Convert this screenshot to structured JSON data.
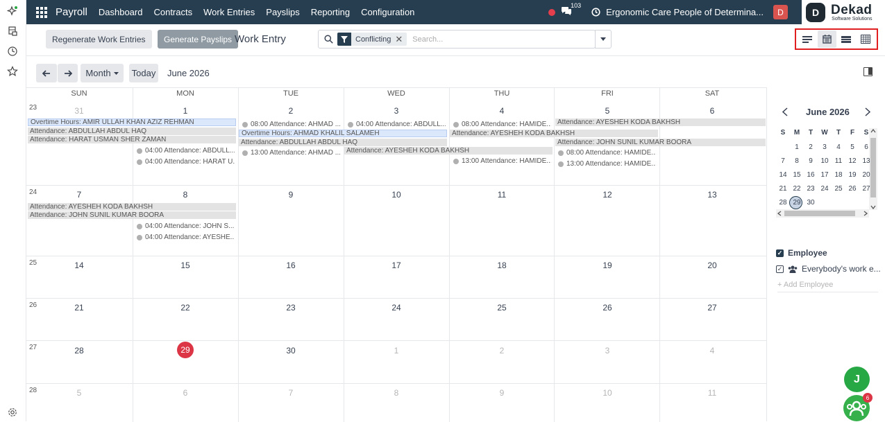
{
  "topbar": {
    "app_name": "Payroll",
    "menu": [
      "Dashboard",
      "Contracts",
      "Work Entries",
      "Payslips",
      "Reporting",
      "Configuration"
    ],
    "chat_count": "103",
    "company": "Ergonomic Care People of Determina...",
    "user_initial": "D"
  },
  "logo": {
    "name": "Dekad",
    "tagline": "Software Solutions",
    "mark": "D"
  },
  "controls": {
    "regenerate": "Regenerate Work Entries",
    "generate": "Generate Payslips",
    "breadcrumb": "Work Entry",
    "search_facet": "Conflicting",
    "search_placeholder": "Search..."
  },
  "calendar": {
    "scale": "Month",
    "today": "Today",
    "period": "June 2026",
    "weekdays": [
      "SUN",
      "MON",
      "TUE",
      "WED",
      "THU",
      "FRI",
      "SAT"
    ],
    "weeks": [
      {
        "num": "23",
        "days": [
          "31",
          "1",
          "2",
          "3",
          "4",
          "5",
          "6"
        ]
      },
      {
        "num": "24",
        "days": [
          "7",
          "8",
          "9",
          "10",
          "11",
          "12",
          "13"
        ]
      },
      {
        "num": "25",
        "days": [
          "14",
          "15",
          "16",
          "17",
          "18",
          "19",
          "20"
        ]
      },
      {
        "num": "26",
        "days": [
          "21",
          "22",
          "23",
          "24",
          "25",
          "26",
          "27"
        ]
      },
      {
        "num": "27",
        "days": [
          "28",
          "29",
          "30",
          "1",
          "2",
          "3",
          "4"
        ]
      },
      {
        "num": "28",
        "days": [
          "5",
          "6",
          "7",
          "8",
          "9",
          "10",
          "11"
        ]
      }
    ],
    "bars": [
      "Overtime Hours: AMIR ULLAH KHAN AZIZ REHMAN",
      "Attendance: ABDULLAH ABDUL HAQ",
      "Attendance: HARAT USMAN SHER ZAMAN",
      "Overtime Hours: AHMAD KHALIL SALAMEH",
      "Attendance: ABDULLAH ABDUL HAQ",
      "Attendance: AYESHEH KODA BAKHSH",
      "Attendance: AYESHEH KODA BAKHSH",
      "Attendance: AYESHEH KODA BAKHSH",
      "Attendance: JOHN SUNIL KUMAR BOORA",
      "Attendance: AYESHEH KODA BAKHSH",
      "Attendance: JOHN SUNIL KUMAR BOORA"
    ],
    "events": [
      "04:00 Attendance: ABDULL...",
      "04:00 Attendance: HARAT U...",
      "08:00 Attendance: AHMAD ...",
      "13:00 Attendance: AHMAD ...",
      "04:00 Attendance: ABDULL...",
      "08:00 Attendance: HAMIDE...",
      "13:00 Attendance: HAMIDE...",
      "08:00 Attendance: HAMIDE...",
      "13:00 Attendance: HAMIDE...",
      "04:00 Attendance: JOHN S...",
      "04:00 Attendance: AYESHE..."
    ]
  },
  "sidebar": {
    "mini_title": "June 2026",
    "mini_dow": [
      "S",
      "M",
      "T",
      "W",
      "T",
      "F",
      "S"
    ],
    "mini_rows": [
      [
        "",
        "1",
        "2",
        "3",
        "4",
        "5",
        "6"
      ],
      [
        "7",
        "8",
        "9",
        "10",
        "11",
        "12",
        "13"
      ],
      [
        "14",
        "15",
        "16",
        "17",
        "18",
        "19",
        "20"
      ],
      [
        "21",
        "22",
        "23",
        "24",
        "25",
        "26",
        "27"
      ],
      [
        "28",
        "29",
        "30",
        "",
        "",
        "",
        ""
      ]
    ],
    "filter_title": "Employee",
    "filter_item": "Everybody's work e...",
    "add_employee": "+ Add Employee"
  },
  "bubbles": {
    "assistant_initial": "J",
    "group_badge": "6"
  },
  "colors": {
    "topbar": "#263e50",
    "today": "#dc3545",
    "highlight": "#e02020"
  }
}
